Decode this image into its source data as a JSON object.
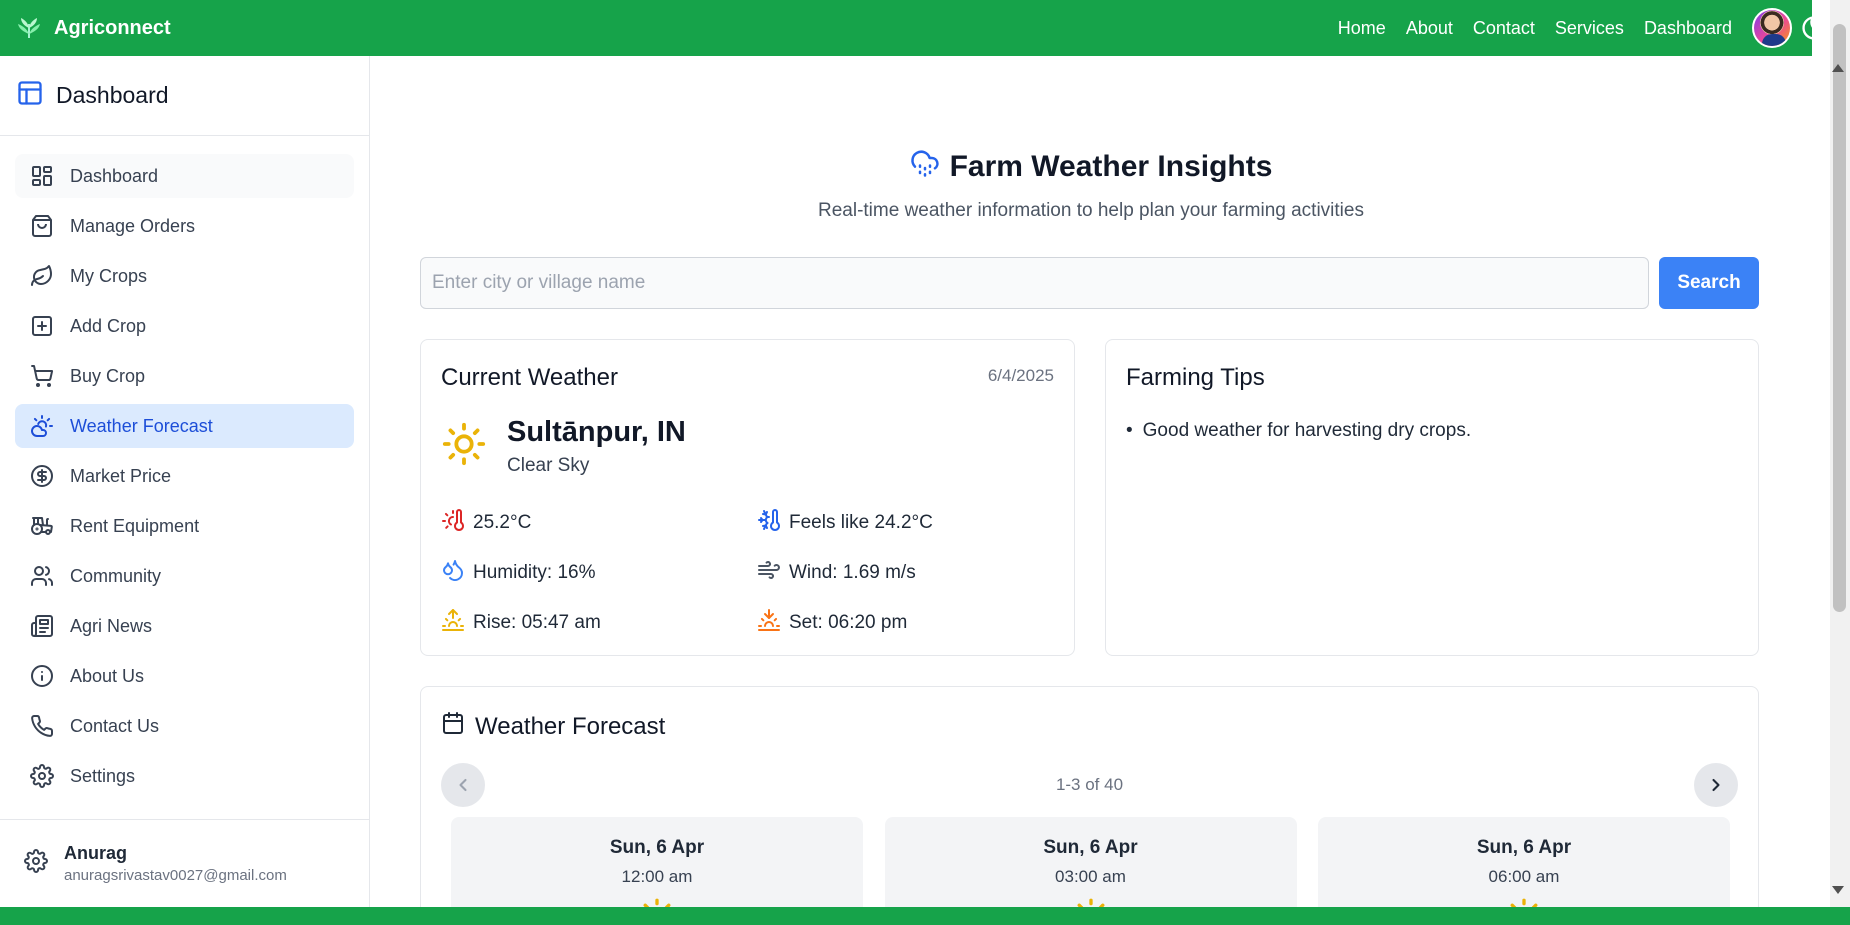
{
  "app": {
    "brand": "Agriconnect",
    "brand_color": "#16a34a",
    "accent_color": "#3b82f6"
  },
  "nav": {
    "links": [
      "Home",
      "About",
      "Contact",
      "Services",
      "Dashboard"
    ],
    "avatar_icon": "user-avatar",
    "theme_icon": "moon-icon"
  },
  "sidebar": {
    "title": "Dashboard",
    "items": [
      {
        "label": "Dashboard",
        "icon": "grid-icon"
      },
      {
        "label": "Manage Orders",
        "icon": "shopping-bag-icon"
      },
      {
        "label": "My Crops",
        "icon": "leaf-icon"
      },
      {
        "label": "Add Crop",
        "icon": "plus-square-icon"
      },
      {
        "label": "Buy Crop",
        "icon": "cart-icon"
      },
      {
        "label": "Weather Forecast",
        "icon": "cloud-sun-icon",
        "active": true
      },
      {
        "label": "Market Price",
        "icon": "dollar-circle-icon"
      },
      {
        "label": "Rent Equipment",
        "icon": "tractor-icon"
      },
      {
        "label": "Community",
        "icon": "users-icon"
      },
      {
        "label": "Agri News",
        "icon": "newspaper-icon"
      },
      {
        "label": "About Us",
        "icon": "info-icon"
      },
      {
        "label": "Contact Us",
        "icon": "phone-icon"
      },
      {
        "label": "Settings",
        "icon": "gear-icon"
      }
    ],
    "user": {
      "name": "Anurag",
      "email": "anuragsrivastav0027@gmail.com"
    }
  },
  "hero": {
    "title": "Farm Weather Insights",
    "subtitle": "Real-time weather information to help plan your farming activities"
  },
  "search": {
    "placeholder": "Enter city or village name",
    "value": "",
    "button": "Search"
  },
  "current_weather": {
    "title": "Current Weather",
    "date": "6/4/2025",
    "city": "Sultānpur, IN",
    "condition": "Clear Sky",
    "temp": "25.2°C",
    "feels_like": "Feels like 24.2°C",
    "humidity": "Humidity: 16%",
    "wind": "Wind: 1.69 m/s",
    "sunrise": "Rise: 05:47 am",
    "sunset": "Set: 06:20 pm"
  },
  "farming_tips": {
    "title": "Farming Tips",
    "tips": [
      "Good weather for harvesting dry crops."
    ]
  },
  "forecast": {
    "title": "Weather Forecast",
    "pager": "1-3 of 40",
    "days": [
      {
        "date": "Sun, 6 Apr",
        "time": "12:00 am"
      },
      {
        "date": "Sun, 6 Apr",
        "time": "03:00 am"
      },
      {
        "date": "Sun, 6 Apr",
        "time": "06:00 am"
      }
    ]
  }
}
